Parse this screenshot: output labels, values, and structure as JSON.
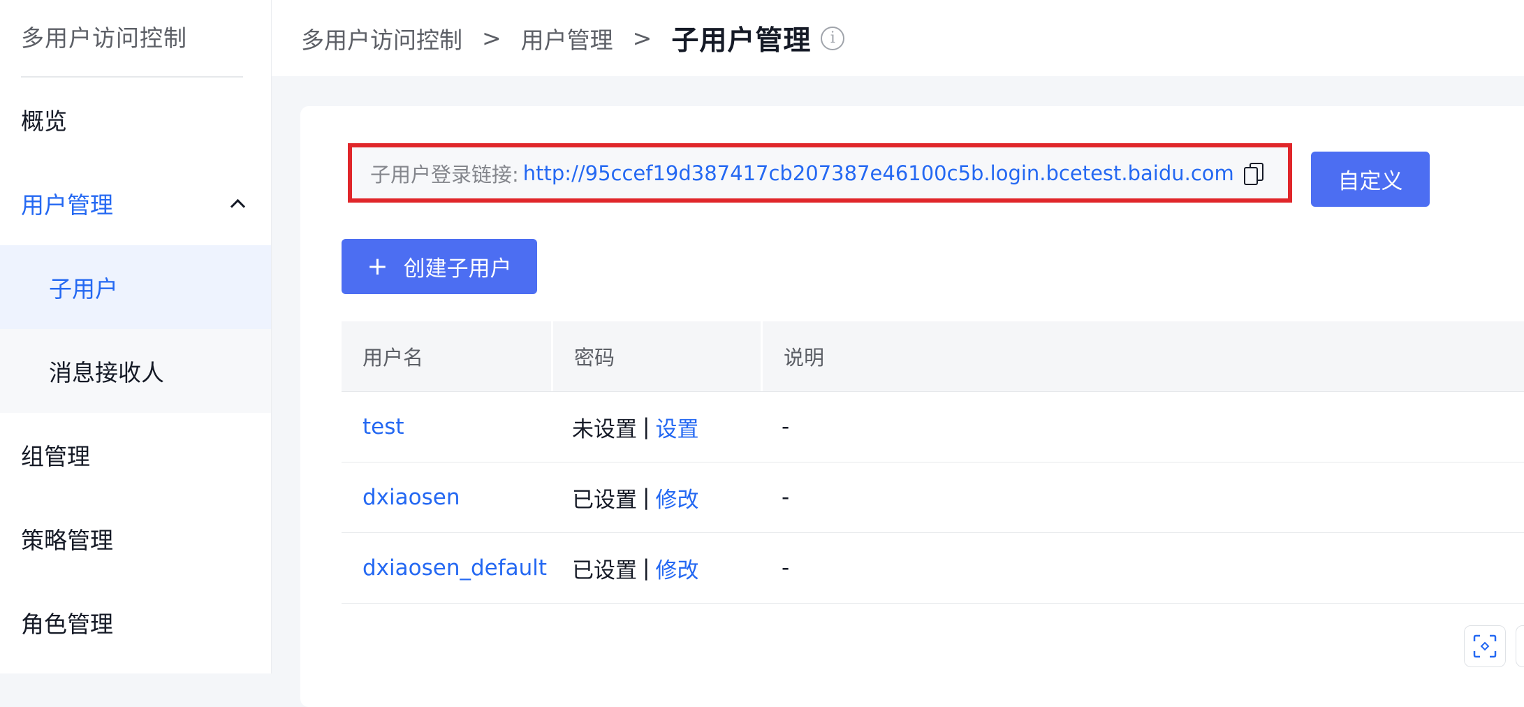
{
  "sidebar": {
    "title": "多用户访问控制",
    "items": [
      {
        "label": "概览"
      },
      {
        "label": "用户管理"
      },
      {
        "label": "子用户"
      },
      {
        "label": "消息接收人"
      },
      {
        "label": "组管理"
      },
      {
        "label": "策略管理"
      },
      {
        "label": "角色管理"
      }
    ]
  },
  "header": {
    "breadcrumb": [
      "多用户访问控制",
      "用户管理"
    ],
    "separator": ">",
    "current": "子用户管理",
    "info_glyph": "i"
  },
  "login_link": {
    "label": "子用户登录链接:",
    "url": "http://95ccef19d387417cb207387e46100c5b.login.bcetest.baidu.com"
  },
  "buttons": {
    "customize": "自定义",
    "create_plus": "+",
    "create": "创建子用户"
  },
  "table": {
    "headers": [
      "用户名",
      "密码",
      "说明"
    ],
    "rows": [
      {
        "username": "test",
        "password_status": "未设置",
        "sep": "|",
        "action": "设置",
        "description": "-"
      },
      {
        "username": "dxiaosen",
        "password_status": "已设置",
        "sep": "|",
        "action": "修改",
        "description": "-"
      },
      {
        "username": "dxiaosen_default",
        "password_status": "已设置",
        "sep": "|",
        "action": "修改",
        "description": "-"
      }
    ]
  },
  "colors": {
    "accent": "#2468f2",
    "button": "#4c6ef2",
    "highlight_border": "#e0262a"
  },
  "icons": [
    "info-icon",
    "chevron-up-icon",
    "copy-icon",
    "plus-icon",
    "scan-icon"
  ]
}
